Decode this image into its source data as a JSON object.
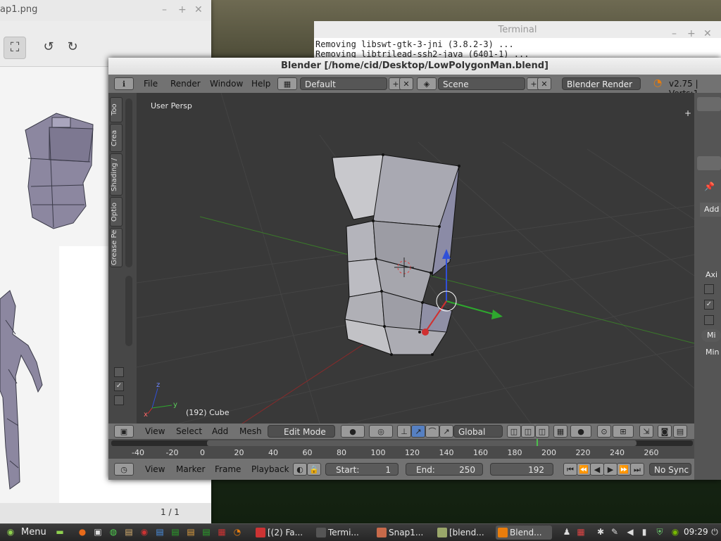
{
  "viewer": {
    "title": "ap1.png",
    "status": "1 / 1",
    "min_glyph": "–",
    "max_glyph": "+",
    "close_glyph": "✕",
    "fullscreen_glyph": "⛶",
    "rotate_left_glyph": "↺",
    "rotate_right_glyph": "↻"
  },
  "terminal": {
    "title": "Terminal",
    "lines": [
      "Removing libswt-gtk-3-jni (3.8.2-3) ...",
      "Removing libtrilead-ssh2-java (6401-1) ..."
    ],
    "min_glyph": "–",
    "max_glyph": "+",
    "close_glyph": "✕"
  },
  "blender": {
    "title": "Blender [/home/cid/Desktop/LowPolygonMan.blend]",
    "menu": {
      "file": "File",
      "render": "Render",
      "window": "Window",
      "help": "Help"
    },
    "info_glyph": "ℹ",
    "layout": "Default",
    "scene": "Scene",
    "engine": "Blender Render",
    "version": "v2.75 | Verts:1",
    "toolshelf_tabs": [
      "Too",
      "Crea",
      "Shading /",
      "Optio",
      "Grease Pe"
    ],
    "viewport": {
      "persp_label": "User Persp",
      "object_label": "(192) Cube",
      "axis_z": "z",
      "axis_x": "x",
      "axis_y": "y",
      "plus_glyph": "+"
    },
    "view3d_header": {
      "view": "View",
      "select": "Select",
      "add": "Add",
      "mesh": "Mesh",
      "mode": "Edit Mode",
      "orientation": "Global"
    },
    "timeline": {
      "ticks": [
        "-40",
        "-20",
        "0",
        "20",
        "40",
        "60",
        "80",
        "100",
        "120",
        "140",
        "160",
        "180",
        "200",
        "220",
        "240",
        "260"
      ],
      "current_frame_marker": 194,
      "view": "View",
      "marker": "Marker",
      "frame": "Frame",
      "playback": "Playback",
      "start_label": "Start:",
      "start_value": "1",
      "end_label": "End:",
      "end_value": "250",
      "current": "192",
      "sync": "No Sync"
    },
    "rpanel": {
      "add": "Add",
      "axi": "Axi",
      "mi": "Mi",
      "min": "Min"
    }
  },
  "taskbar": {
    "menu": "Menu",
    "tasks": [
      "[(2) Fa...",
      "Termi...",
      "Snap1...",
      "[blend...",
      "Blend..."
    ],
    "clock": "09:29"
  },
  "colors": {
    "accent_orange": "#e87d0d",
    "blender_bg": "#393939",
    "axis_red": "#d03030",
    "axis_green": "#2ea82e",
    "axis_blue": "#3050d8"
  }
}
